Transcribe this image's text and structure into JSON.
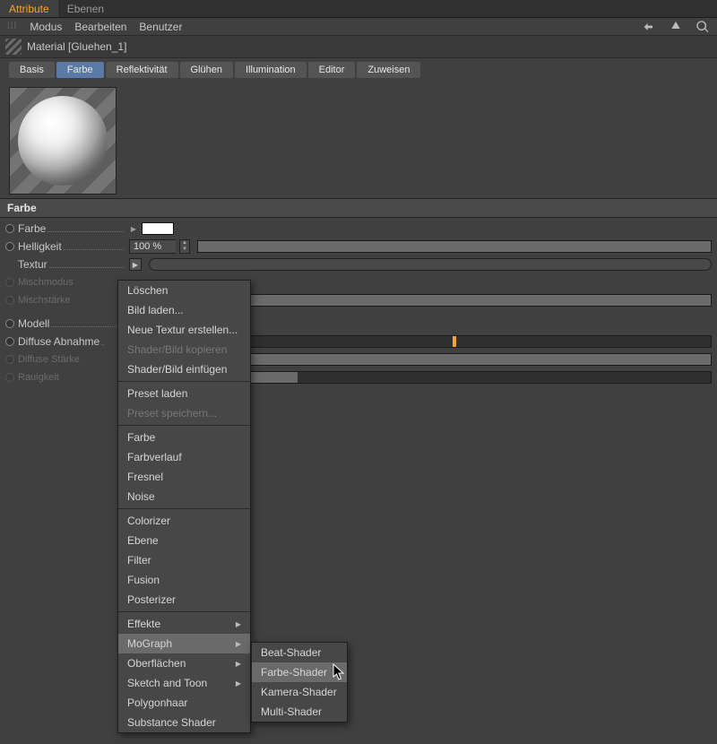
{
  "tabs": {
    "attribute": "Attribute",
    "ebenen": "Ebenen"
  },
  "menus": {
    "modus": "Modus",
    "bearbeiten": "Bearbeiten",
    "benutzer": "Benutzer"
  },
  "title": "Material [Gluehen_1]",
  "ptabs": {
    "basis": "Basis",
    "farbe": "Farbe",
    "reflekt": "Reflektivität",
    "gluehen": "Glühen",
    "illum": "Illumination",
    "editor": "Editor",
    "zuweisen": "Zuweisen"
  },
  "section": "Farbe",
  "params": {
    "farbe": "Farbe",
    "helligkeit": "Helligkeit",
    "helligkeit_val": "100 %",
    "textur": "Textur",
    "mischmodus": "Mischmodus",
    "mischstaerke": "Mischstärke",
    "modell": "Modell",
    "diffabnahme": "Diffuse Abnahme",
    "diffstaerke": "Diffuse Stärke",
    "rauigkeit": "Rauigkeit"
  },
  "ctx": {
    "g1": [
      "Löschen",
      "Bild laden...",
      "Neue Textur erstellen...",
      "Shader/Bild kopieren",
      "Shader/Bild einfügen"
    ],
    "g1_dis": [
      3
    ],
    "g2": [
      "Preset laden",
      "Preset speichern..."
    ],
    "g2_dis": [
      1
    ],
    "g3": [
      "Farbe",
      "Farbverlauf",
      "Fresnel",
      "Noise"
    ],
    "g4": [
      "Colorizer",
      "Ebene",
      "Filter",
      "Fusion",
      "Posterizer"
    ],
    "g5": [
      {
        "label": "Effekte",
        "sub": true
      },
      {
        "label": "MoGraph",
        "sub": true,
        "hover": true
      },
      {
        "label": "Oberflächen",
        "sub": true
      },
      {
        "label": "Sketch and Toon",
        "sub": true
      },
      {
        "label": "Polygonhaar",
        "sub": false
      },
      {
        "label": "Substance Shader",
        "sub": false
      }
    ]
  },
  "submenu": {
    "items": [
      "Beat-Shader",
      "Farbe-Shader",
      "Kamera-Shader",
      "Multi-Shader"
    ],
    "hover_index": 1
  }
}
